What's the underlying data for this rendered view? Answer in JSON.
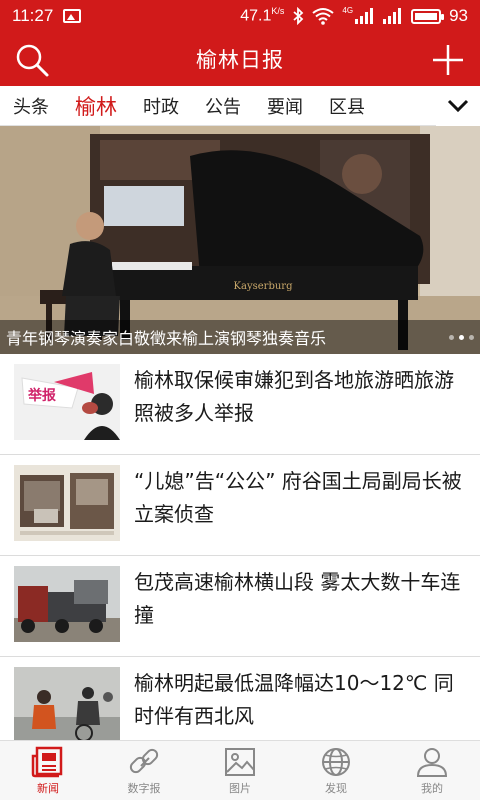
{
  "status_bar": {
    "time": "11:27",
    "speed": "47.1",
    "speed_unit": "K/s",
    "network": "4G",
    "battery": "93"
  },
  "header": {
    "title": "榆林日报"
  },
  "tabs": [
    {
      "label": "头条",
      "active": false
    },
    {
      "label": "榆林",
      "active": true
    },
    {
      "label": "时政",
      "active": false
    },
    {
      "label": "公告",
      "active": false
    },
    {
      "label": "要闻",
      "active": false
    },
    {
      "label": "区县",
      "active": false
    }
  ],
  "banner": {
    "caption": "青年钢琴演奏家白敬徵来榆上演钢琴独奏音乐",
    "piano_brand": "Kayserburg",
    "page_dots": 3,
    "active_dot": 1
  },
  "news": [
    {
      "headline": "榆林取保候审嫌犯到各地旅游晒旅游照被多人举报",
      "thumb_text": "举报"
    },
    {
      "headline": "“儿媳”告“公公” 府谷国土局副局长被立案侦查"
    },
    {
      "headline": "包茂高速榆林横山段 雾太大数十车连撞"
    },
    {
      "headline": "榆林明起最低温降幅达10～12℃ 同时伴有西北风"
    }
  ],
  "bottom_nav": [
    {
      "label": "新闻",
      "icon": "newspaper-icon",
      "active": true
    },
    {
      "label": "数字报",
      "icon": "link-icon",
      "active": false
    },
    {
      "label": "图片",
      "icon": "image-icon",
      "active": false
    },
    {
      "label": "发现",
      "icon": "globe-icon",
      "active": false
    },
    {
      "label": "我的",
      "icon": "person-icon",
      "active": false
    }
  ],
  "colors": {
    "brand_red": "#d11a1a",
    "nav_inactive": "#888888"
  }
}
